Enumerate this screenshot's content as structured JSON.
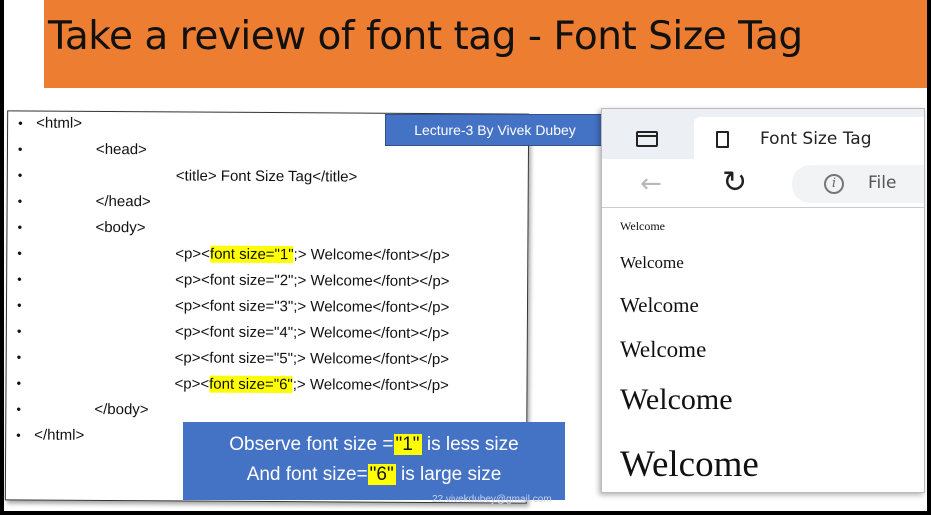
{
  "slide": {
    "title": "Take a review of font tag - Font Size Tag",
    "lecture_label": "Lecture-3 By Vivek Dubey",
    "code_lines": [
      {
        "pre": "<html>",
        "hl": "",
        "post": ""
      },
      {
        "pre": "<head>",
        "hl": "",
        "post": ""
      },
      {
        "pre": "<title> Font Size Tag</title>",
        "hl": "",
        "post": ""
      },
      {
        "pre": "</head>",
        "hl": "",
        "post": ""
      },
      {
        "pre": "<body>",
        "hl": "",
        "post": ""
      },
      {
        "pre": "<p><",
        "hl": "font size=\"1\"",
        "post": ";> Welcome</font></p>"
      },
      {
        "pre": "<p><font size=\"2\";> Welcome</font></p>",
        "hl": "",
        "post": ""
      },
      {
        "pre": "<p><font size=\"3\";> Welcome</font></p>",
        "hl": "",
        "post": ""
      },
      {
        "pre": "<p><font size=\"4\";> Welcome</font></p>",
        "hl": "",
        "post": ""
      },
      {
        "pre": "<p><font size=\"5\";> Welcome</font></p>",
        "hl": "",
        "post": ""
      },
      {
        "pre": "<p><",
        "hl": "font size=\"6\"",
        "post": ";> Welcome</font></p>"
      },
      {
        "pre": "</body>",
        "hl": "",
        "post": ""
      },
      {
        "pre": "</html>",
        "hl": "",
        "post": ""
      }
    ],
    "observe": {
      "line1_pre": "Observe font size =",
      "line1_q": "\"1\"",
      "line1_post": " is less size",
      "line2_pre": "And font size=",
      "line2_q": "\"6\"",
      "line2_post": " is large size"
    },
    "email": "22.vivekdubey@gmail.com"
  },
  "browser": {
    "tab_title": "Font Size Tag",
    "address_text": "File",
    "back_icon": "back-arrow-icon",
    "reload_icon": "reload-icon",
    "info_icon": "info-icon",
    "welcomes": [
      "Welcome",
      "Welcome",
      "Welcome",
      "Welcome",
      "Welcome",
      "Welcome"
    ]
  },
  "colors": {
    "title_bar": "#ed7d31",
    "label_bg": "#4472c4",
    "highlight": "#ffff00"
  }
}
